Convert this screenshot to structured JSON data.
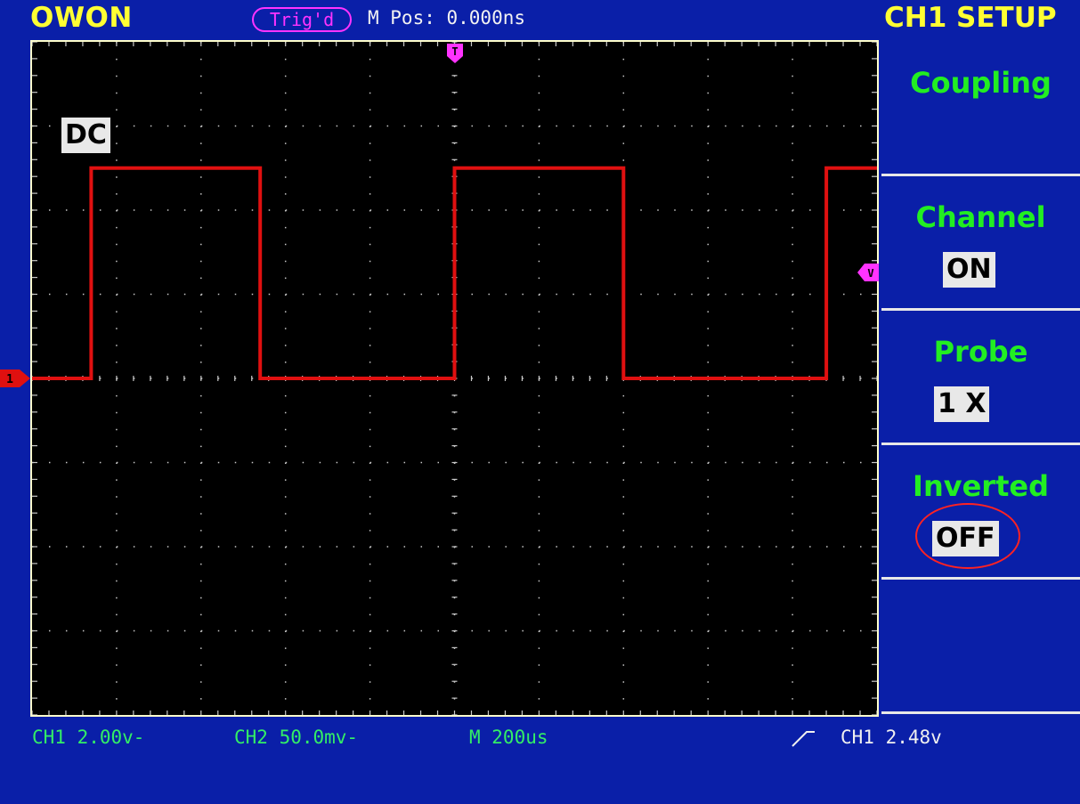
{
  "header": {
    "brand": "OWON",
    "trigger_status": "Trig'd",
    "m_pos": "M Pos: 0.000ns"
  },
  "menu": {
    "title": "CH1 SETUP",
    "items": [
      {
        "label": "Coupling",
        "value": "DC"
      },
      {
        "label": "Channel",
        "value": "ON"
      },
      {
        "label": "Probe",
        "value": "1 X"
      },
      {
        "label": "Inverted",
        "value": "OFF"
      },
      {
        "label": "",
        "value": ""
      }
    ]
  },
  "status": {
    "ch1_scale": "CH1 2.00v-",
    "ch2_scale": "CH2 50.0mv-",
    "timebase": "M 200us",
    "trigger": "CH1 2.48v"
  },
  "markers": {
    "trigger_pos": "T",
    "trigger_level": "V",
    "ch1": "1"
  },
  "colors": {
    "background": "#0a1fa8",
    "screen": "#000000",
    "ch1_trace": "#e01010",
    "brand": "#ffff33",
    "menu_label": "#22ee22",
    "trigger": "#ff33ff",
    "status": "#33ee66"
  },
  "waveform": {
    "type": "square",
    "low_div": 0,
    "high_div": 2.5,
    "edges": [
      {
        "time_div": -4.3,
        "to": "high"
      },
      {
        "time_div": -2.3,
        "to": "low"
      },
      {
        "time_div": 0.0,
        "to": "high"
      },
      {
        "time_div": 2.0,
        "to": "low"
      },
      {
        "time_div": 4.4,
        "to": "high"
      }
    ]
  }
}
